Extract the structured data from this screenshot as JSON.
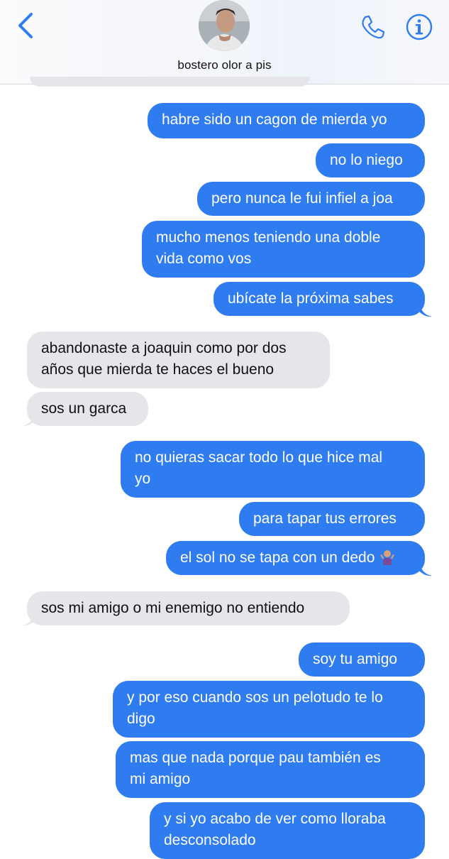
{
  "header": {
    "contact_name": "bostero olor a pis"
  },
  "colors": {
    "outgoing_bubble": "#2f7bf0",
    "incoming_bubble": "#e5e5ea",
    "accent": "#2f7bf0"
  },
  "icons": {
    "back": "chevron-left-icon",
    "phone": "phone-icon",
    "info": "info-icon"
  },
  "messages": [
    {
      "side": "out",
      "text": "habre sido un cagon de mierda yo"
    },
    {
      "side": "out",
      "text": "no lo niego"
    },
    {
      "side": "out",
      "text": "pero nunca le fui infiel a joa"
    },
    {
      "side": "out",
      "line1": "mucho menos teniendo una doble",
      "line2": "vida como vos"
    },
    {
      "side": "out",
      "text": "ubícate la próxima sabes"
    },
    {
      "side": "in",
      "line1": "abandonaste a joaquin como por dos",
      "line2": "años que mierda te haces el bueno"
    },
    {
      "side": "in",
      "text": "sos un garca"
    },
    {
      "side": "out",
      "line1": "no quieras sacar todo lo que hice mal",
      "line2": "yo"
    },
    {
      "side": "out",
      "text": "para tapar tus errores"
    },
    {
      "side": "out",
      "text": "el sol no se tapa con un dedo"
    },
    {
      "side": "in",
      "text": "sos mi amigo o mi enemigo no entiendo"
    },
    {
      "side": "out",
      "text": "soy tu amigo"
    },
    {
      "side": "out",
      "line1": "y por eso cuando sos un pelotudo te lo",
      "line2": "digo"
    },
    {
      "side": "out",
      "line1": "mas que nada porque pau también es",
      "line2": "mi amigo"
    },
    {
      "side": "out",
      "line1": "y si yo acabo de ver como lloraba",
      "line2": "desconsolado"
    }
  ]
}
